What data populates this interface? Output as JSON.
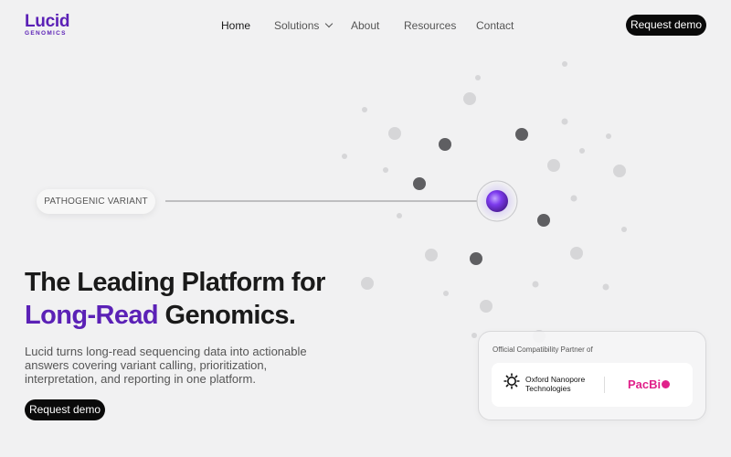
{
  "brand": {
    "name": "Lucid",
    "subtitle": "GENOMICS",
    "color": "#5b21b6"
  },
  "nav": {
    "items": [
      {
        "label": "Home",
        "active": true
      },
      {
        "label": "Solutions",
        "has_dropdown": true
      },
      {
        "label": "About"
      },
      {
        "label": "Resources"
      },
      {
        "label": "Contact"
      }
    ],
    "cta_label": "Request demo"
  },
  "visual": {
    "pill_label": "PATHOGENIC VARIANT",
    "dot_light": "#d6d6d8",
    "dot_dark": "#5f5f62",
    "core_color": "#7c3aed"
  },
  "hero": {
    "title_line1": "The Leading Platform for",
    "title_accent": "Long-Read",
    "title_rest": " Genomics.",
    "description": "Lucid turns long-read sequencing data into actionable answers covering variant calling, prioritization, interpretation, and reporting in one platform.",
    "cta_label": "Request demo"
  },
  "partners": {
    "label": "Official Compatibility Partner of",
    "ont_line1": "Oxford Nanopore",
    "ont_line2": "Technologies",
    "pacbio_text": "PacBi",
    "pacbio_color": "#e0218a"
  }
}
